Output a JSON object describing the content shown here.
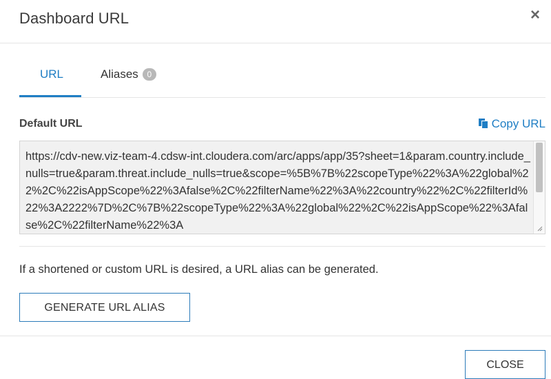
{
  "dialog": {
    "title": "Dashboard URL",
    "close_glyph": "×"
  },
  "tabs": [
    {
      "label": "URL",
      "active": true
    },
    {
      "label": "Aliases",
      "badge": "0",
      "active": false
    }
  ],
  "default_url": {
    "label": "Default URL",
    "copy_label": "Copy URL",
    "value": "https://cdv-new.viz-team-4.cdsw-int.cloudera.com/arc/apps/app/35?sheet=1&param.country.include_nulls=true&param.threat.include_nulls=true&scope=%5B%7B%22scopeType%22%3A%22global%22%2C%22isAppScope%22%3Afalse%2C%22filterName%22%3A%22country%22%2C%22filterId%22%3A2222%7D%2C%7B%22scopeType%22%3A%22global%22%2C%22isAppScope%22%3Afalse%2C%22filterName%22%3A"
  },
  "alias": {
    "info": "If a shortened or custom URL is desired, a URL alias can be generated.",
    "generate_label": "GENERATE URL ALIAS"
  },
  "footer": {
    "close_label": "CLOSE"
  },
  "colors": {
    "accent": "#1f7ec4",
    "button_border": "#2b7bb9",
    "textarea_bg": "#f1f1f1"
  },
  "icons": {
    "copy": "copy-icon",
    "close": "close-icon"
  }
}
